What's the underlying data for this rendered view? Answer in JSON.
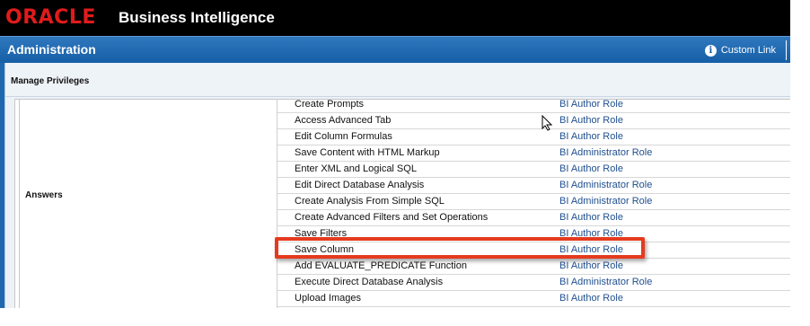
{
  "header": {
    "logo_text": "ORACLE",
    "app_title": "Business Intelligence"
  },
  "adminbar": {
    "title": "Administration",
    "custom_link": "Custom Link",
    "info_icon": "info-icon"
  },
  "panel": {
    "title": "Manage Privileges",
    "group_label": "Answers"
  },
  "privileges": [
    {
      "name": "Create Prompts",
      "role": "BI Author Role"
    },
    {
      "name": "Access Advanced Tab",
      "role": "BI Author Role"
    },
    {
      "name": "Edit Column Formulas",
      "role": "BI Author Role"
    },
    {
      "name": "Save Content with HTML Markup",
      "role": "BI Administrator Role"
    },
    {
      "name": "Enter XML and Logical SQL",
      "role": "BI Author Role"
    },
    {
      "name": "Edit Direct Database Analysis",
      "role": "BI Administrator Role"
    },
    {
      "name": "Create Analysis From Simple SQL",
      "role": "BI Administrator Role"
    },
    {
      "name": "Create Advanced Filters and Set Operations",
      "role": "BI Author Role"
    },
    {
      "name": "Save Filters",
      "role": "BI Author Role"
    },
    {
      "name": "Save Column",
      "role": "BI Author Role"
    },
    {
      "name": "Add EVALUATE_PREDICATE Function",
      "role": "BI Author Role"
    },
    {
      "name": "Execute Direct Database Analysis",
      "role": "BI Administrator Role"
    },
    {
      "name": "Upload Images",
      "role": "BI Author Role"
    }
  ],
  "colors": {
    "accent": "#155ea6",
    "logo_red": "#e01b1b",
    "highlight": "#e53a1e",
    "role_link": "#1f4f8f"
  }
}
